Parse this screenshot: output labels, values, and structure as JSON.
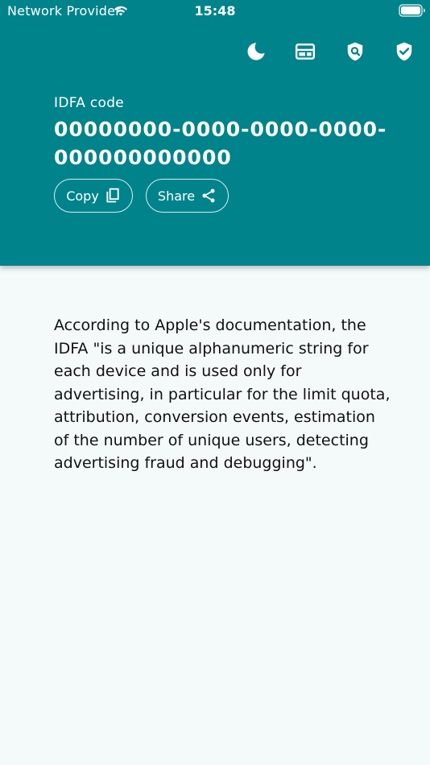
{
  "status_bar": {
    "carrier": "Network Provider",
    "time": "15:48"
  },
  "toolbar": {
    "icons": [
      "moon-icon",
      "ad-panel-icon",
      "privacy-search-icon",
      "verified-shield-icon"
    ]
  },
  "idfa": {
    "label": "IDFA code",
    "value": "00000000-0000-0000-0000-000000000000"
  },
  "buttons": {
    "copy_label": "Copy",
    "share_label": "Share"
  },
  "description": "According to Apple's documentation, the IDFA \"is a unique alphanumeric string for each device and is used only for advertising, in particular for the limit quota, attribution, conversion events, estimation of the number of unique users, detecting advertising fraud and debugging\".",
  "colors": {
    "header": "#00838b",
    "background": "#f4fafa",
    "text": "#111111"
  }
}
